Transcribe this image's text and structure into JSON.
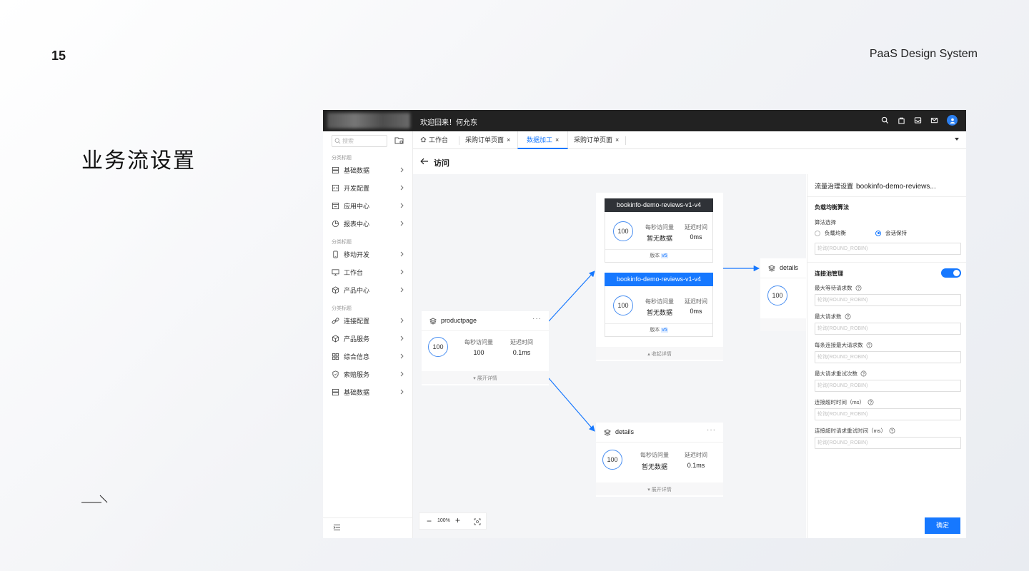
{
  "slide": {
    "page_number": "15",
    "brand": "PaaS Design System",
    "title": "业务流设置"
  },
  "app": {
    "welcome": "欢迎回来！何允东",
    "top_icons": [
      "search-icon",
      "bag-icon",
      "inbox-icon",
      "mail-icon",
      "avatar"
    ],
    "sidebar": {
      "search_placeholder": "搜索",
      "groups": [
        {
          "label": "分类标题",
          "items": [
            {
              "label": "基础数据",
              "icon": "database-icon"
            },
            {
              "label": "开发配置",
              "icon": "code-icon"
            },
            {
              "label": "应用中心",
              "icon": "app-icon"
            },
            {
              "label": "报表中心",
              "icon": "pie-icon"
            }
          ]
        },
        {
          "label": "分类标题",
          "items": [
            {
              "label": "移动开发",
              "icon": "mobile-icon"
            },
            {
              "label": "工作台",
              "icon": "monitor-icon"
            },
            {
              "label": "产品中心",
              "icon": "cube-icon"
            }
          ]
        },
        {
          "label": "分类标题",
          "items": [
            {
              "label": "连接配置",
              "icon": "link-icon"
            },
            {
              "label": "产品服务",
              "icon": "cube-icon"
            },
            {
              "label": "综合信息",
              "icon": "grid-icon"
            },
            {
              "label": "索赔服务",
              "icon": "shield-icon"
            },
            {
              "label": "基础数据",
              "icon": "database-icon"
            }
          ]
        }
      ]
    },
    "tabs": [
      {
        "label": "工作台",
        "closable": false,
        "active": false
      },
      {
        "label": "采购订单页面",
        "closable": true,
        "active": false
      },
      {
        "label": "数据加工",
        "closable": true,
        "active": true
      },
      {
        "label": "采购订单页面",
        "closable": true,
        "active": false
      }
    ],
    "tab_close_glyph": "×",
    "page_title": "访问",
    "canvas": {
      "zoom": "100%",
      "more_glyph": "···",
      "productpage": {
        "name": "productpage",
        "circle": "100",
        "qps_label": "每秒访问量",
        "qps_value": "100",
        "latency_label": "延迟时间",
        "latency_value": "0.1ms",
        "expand": "▾ 展开详情"
      },
      "reviews": {
        "collapse": "▴ 收起详情",
        "versions": [
          {
            "header": "bookinfo-demo-reviews-v1-v4",
            "header_color": "#2f3237",
            "circle": "100",
            "qps_label": "每秒访问量",
            "qps_value": "暂无数据",
            "latency_label": "延迟时间",
            "latency_value": "0ms",
            "version_label": "版本",
            "version_tag": "v5"
          },
          {
            "header": "bookinfo-demo-reviews-v1-v4",
            "header_color": "#1678ff",
            "circle": "100",
            "qps_label": "每秒访问量",
            "qps_value": "暂无数据",
            "latency_label": "延迟时间",
            "latency_value": "0ms",
            "version_label": "版本",
            "version_tag": "v5"
          }
        ]
      },
      "details_right": {
        "name": "details",
        "circle": "100"
      },
      "details_bottom": {
        "name": "details",
        "circle": "100",
        "qps_label": "每秒访问量",
        "qps_value": "暂无数据",
        "latency_label": "延迟时间",
        "latency_value": "0.1ms",
        "expand": "▾ 展开详情"
      }
    },
    "panel": {
      "title": "流量治理设置",
      "title_name": "bookinfo-demo-reviews...",
      "lb_section": "负载均衡算法",
      "algo_label": "算法选择",
      "algo_options": [
        {
          "label": "负载均衡",
          "selected": false
        },
        {
          "label": "会话保持",
          "selected": true
        }
      ],
      "algo_input_placeholder": "轮询(ROUND_ROBIN)",
      "pool_section": "连接池管理",
      "pool_enabled": true,
      "fields": [
        {
          "label": "最大等待请求数",
          "placeholder": "轮询(ROUND_ROBIN)",
          "help": true
        },
        {
          "label": "最大请求数",
          "placeholder": "轮询(ROUND_ROBIN)",
          "help": true
        },
        {
          "label": "每条连接最大请求数",
          "placeholder": "轮询(ROUND_ROBIN)",
          "help": true
        },
        {
          "label": "最大请求重试次数",
          "placeholder": "轮询(ROUND_ROBIN)",
          "help": true
        },
        {
          "label": "连接超时时间（ms）",
          "placeholder": "轮询(ROUND_ROBIN)",
          "help": true
        },
        {
          "label": "连接超时请求重试时间（ms）",
          "placeholder": "轮询(ROUND_ROBIN)",
          "help": true
        }
      ],
      "confirm": "确定"
    },
    "colors": {
      "accent": "#1678ff",
      "topbar": "#222222",
      "dark_header": "#2f3237"
    }
  }
}
